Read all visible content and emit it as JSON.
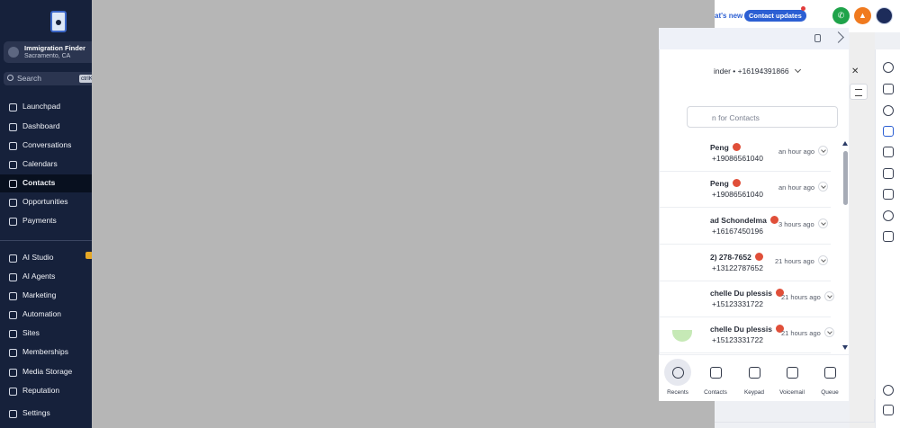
{
  "location": {
    "name": "Immigration Finder",
    "city": "Sacramento, CA"
  },
  "search": {
    "placeholder": "Search",
    "shortcut": "ctrlK"
  },
  "nav": [
    {
      "label": "Launchpad",
      "icon": "rocket-icon",
      "active": false
    },
    {
      "label": "Dashboard",
      "icon": "dashboard-icon",
      "active": false
    },
    {
      "label": "Conversations",
      "icon": "chat-icon",
      "active": false
    },
    {
      "label": "Calendars",
      "icon": "calendar-icon",
      "active": false
    },
    {
      "label": "Contacts",
      "icon": "contacts-icon",
      "active": true
    },
    {
      "label": "Opportunities",
      "icon": "opportunities-icon",
      "active": false
    },
    {
      "label": "Payments",
      "icon": "payments-icon",
      "active": false
    },
    {
      "label": "AI Studio",
      "icon": "ai-studio-icon",
      "active": false
    },
    {
      "label": "AI Agents",
      "icon": "ai-agents-icon",
      "active": false
    },
    {
      "label": "Marketing",
      "icon": "send-icon",
      "active": false
    },
    {
      "label": "Automation",
      "icon": "automation-icon",
      "active": false
    },
    {
      "label": "Sites",
      "icon": "globe-icon",
      "active": false
    },
    {
      "label": "Memberships",
      "icon": "memberships-icon",
      "active": false
    },
    {
      "label": "Media Storage",
      "icon": "image-icon",
      "active": false
    },
    {
      "label": "Reputation",
      "icon": "star-icon",
      "active": false
    },
    {
      "label": "Settings",
      "icon": "gear-icon",
      "active": false
    }
  ],
  "topbar": {
    "whats_new": "at's new",
    "contact_updates": "Contact updates",
    "colors": {
      "phone": "#1fa34a",
      "bell": "#f07a1f",
      "accent": "#2c5fd3"
    }
  },
  "phone": {
    "number_row": "inder • +16194391866",
    "search_placeholder": "n for Contacts",
    "rows": [
      {
        "name": "Peng",
        "number": "+19086561040",
        "time": "an hour ago"
      },
      {
        "name": "Peng",
        "number": "+19086561040",
        "time": "an hour ago"
      },
      {
        "name": "ad Schondelma",
        "number": "+16167450196",
        "time": "3 hours ago"
      },
      {
        "name": "2) 278-7652",
        "number": "+13122787652",
        "time": "21 hours ago"
      },
      {
        "name": "chelle Du plessis",
        "number": "+15123331722",
        "time": "21 hours ago"
      },
      {
        "name": "chelle Du plessis",
        "number": "+15123331722",
        "time": "21 hours ago"
      }
    ],
    "tabs": [
      {
        "label": "Recents",
        "icon": "clock-icon"
      },
      {
        "label": "Contacts",
        "icon": "contact-card-icon"
      },
      {
        "label": "Keypad",
        "icon": "keypad-icon"
      },
      {
        "label": "Voicemail",
        "icon": "voicemail-icon"
      },
      {
        "label": "Queue",
        "icon": "queue-icon"
      }
    ]
  },
  "rail_icons": [
    "history-icon",
    "flow-icon",
    "network-icon",
    "clipboard-icon",
    "pen-icon",
    "calendar-icon",
    "document-icon",
    "dollar-icon",
    "magic-icon",
    "info-icon",
    "keyboard-icon"
  ]
}
